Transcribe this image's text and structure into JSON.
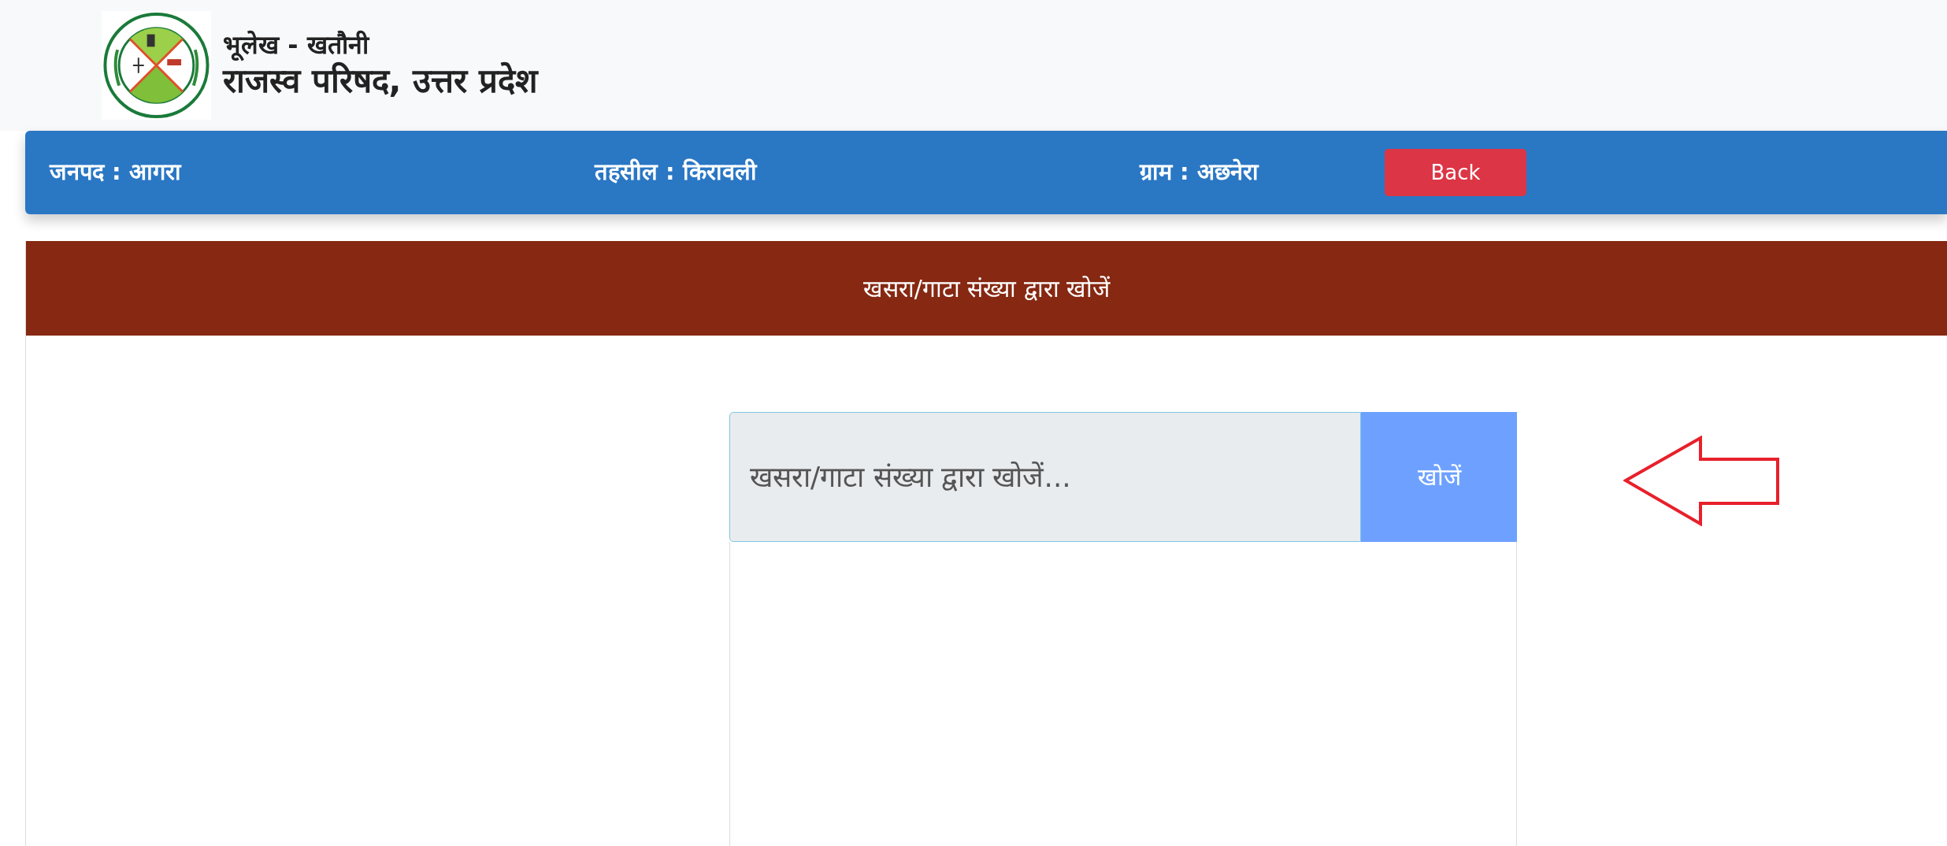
{
  "header": {
    "subtitle": "भूलेख - खतौनी",
    "title": "राजस्व परिषद, उत्तर प्रदेश"
  },
  "location_bar": {
    "fields": [
      {
        "text": "जनपद : आगरा"
      },
      {
        "text": "तहसील : किरावली"
      },
      {
        "text": "ग्राम : अछनेरा"
      }
    ],
    "back_button": "Back"
  },
  "search_card": {
    "title": "खसरा/गाटा संख्या द्वारा खोजें",
    "placeholder": "खसरा/गाटा संख्या द्वारा खोजें...",
    "button": "खोजें"
  }
}
